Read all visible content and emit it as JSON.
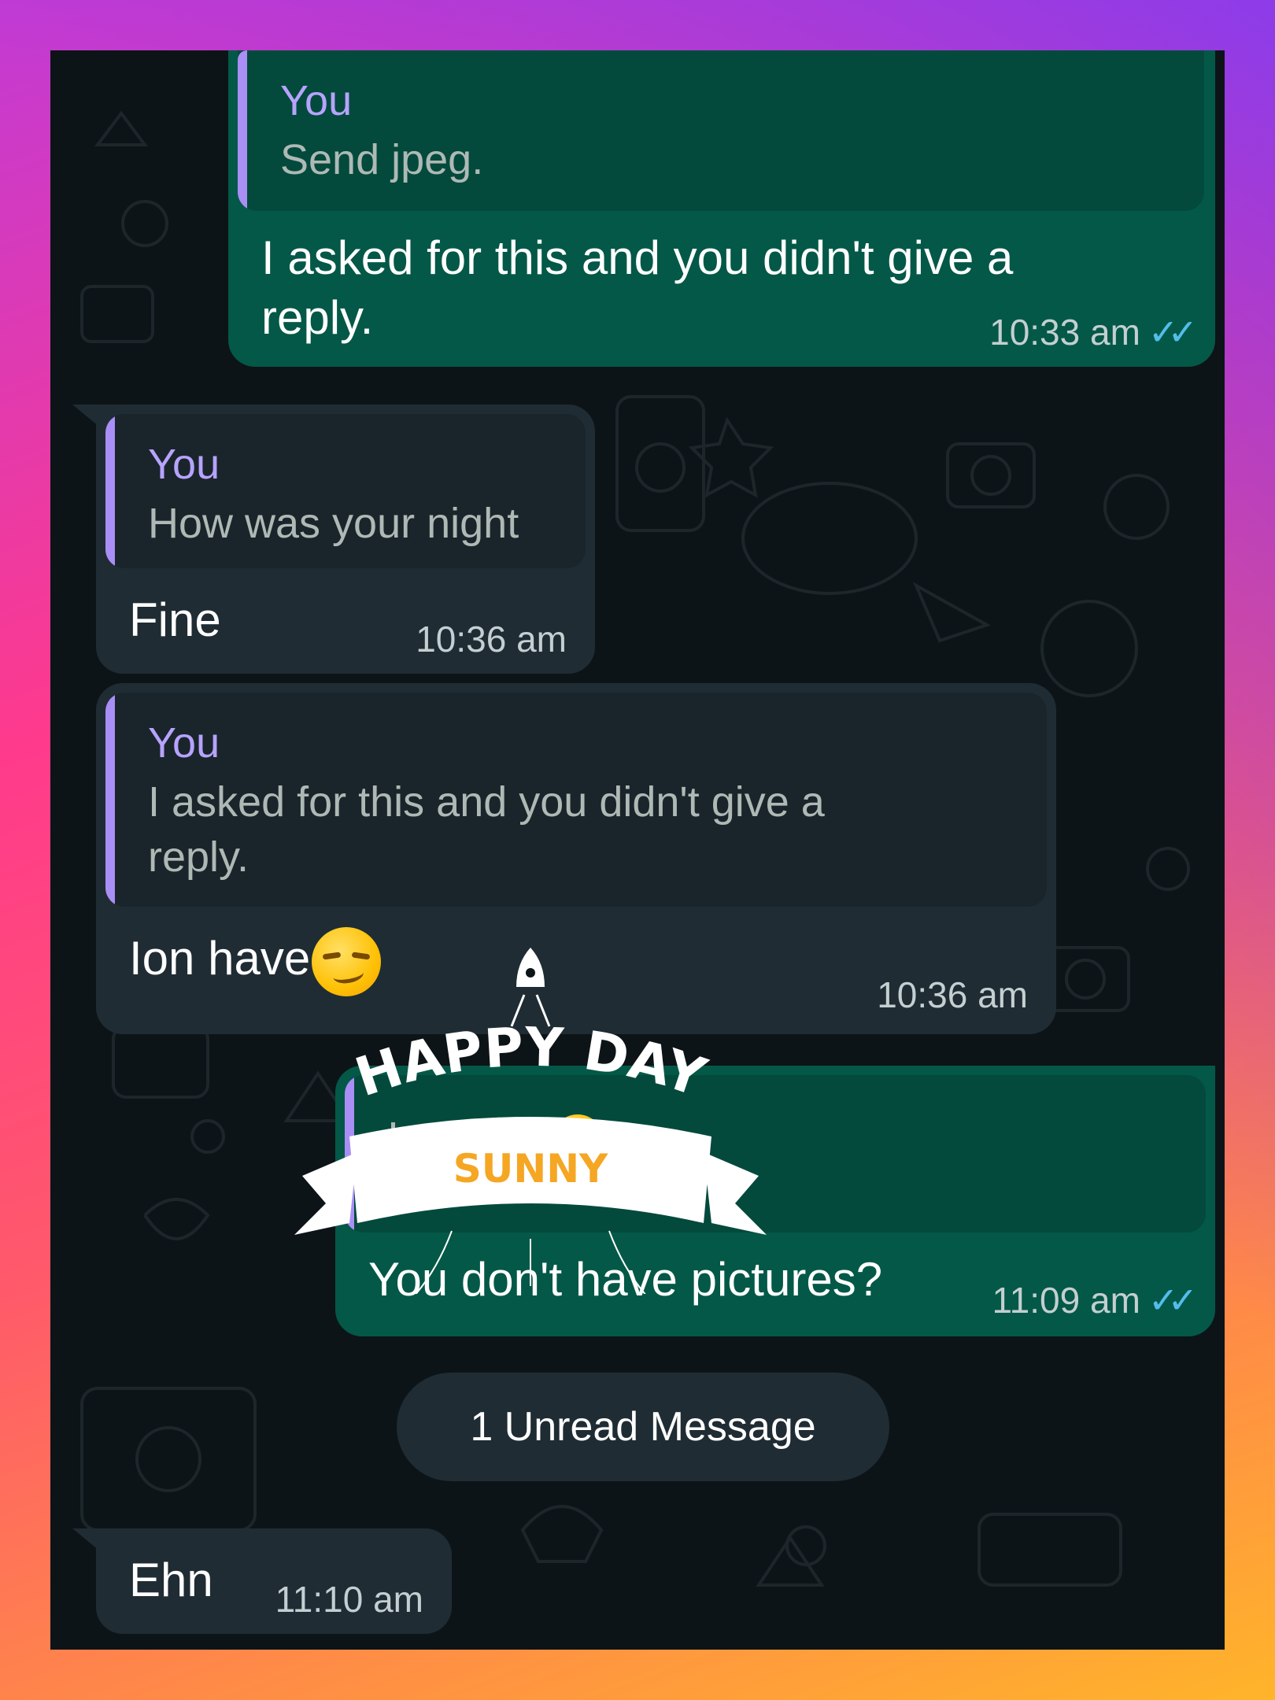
{
  "messages": [
    {
      "direction": "outgoing",
      "quote": {
        "name": "You",
        "text": "Send jpeg."
      },
      "text": "I asked for this and you didn't give a reply.",
      "time": "10:33 am",
      "ticks": "double-check-read"
    },
    {
      "direction": "incoming",
      "quote": {
        "name": "You",
        "text": "How was your night"
      },
      "text": "Fine",
      "time": "10:36 am"
    },
    {
      "direction": "incoming",
      "quote": {
        "name": "You",
        "text": "I asked for this and you didn't give a reply."
      },
      "text": "Ion have",
      "emoji": "smirking-face",
      "time": "10:36 am"
    },
    {
      "direction": "outgoing",
      "quote": {
        "name": "",
        "text": "Ion have",
        "emoji": "smirking-face"
      },
      "text": "You don't have pictures?",
      "time": "11:09 am",
      "ticks": "double-check-read"
    },
    {
      "direction": "incoming",
      "text": "Ehn",
      "time": "11:10 am"
    }
  ],
  "unread_divider": "1 Unread Message",
  "sticker": {
    "line1": "HAPPY DAY",
    "line2": "SUNNY"
  },
  "colors": {
    "outgoing_bubble": "#045847",
    "incoming_bubble": "#1f2c33",
    "quote_name": "#b7a3ff",
    "read_ticks": "#53bdeb"
  }
}
